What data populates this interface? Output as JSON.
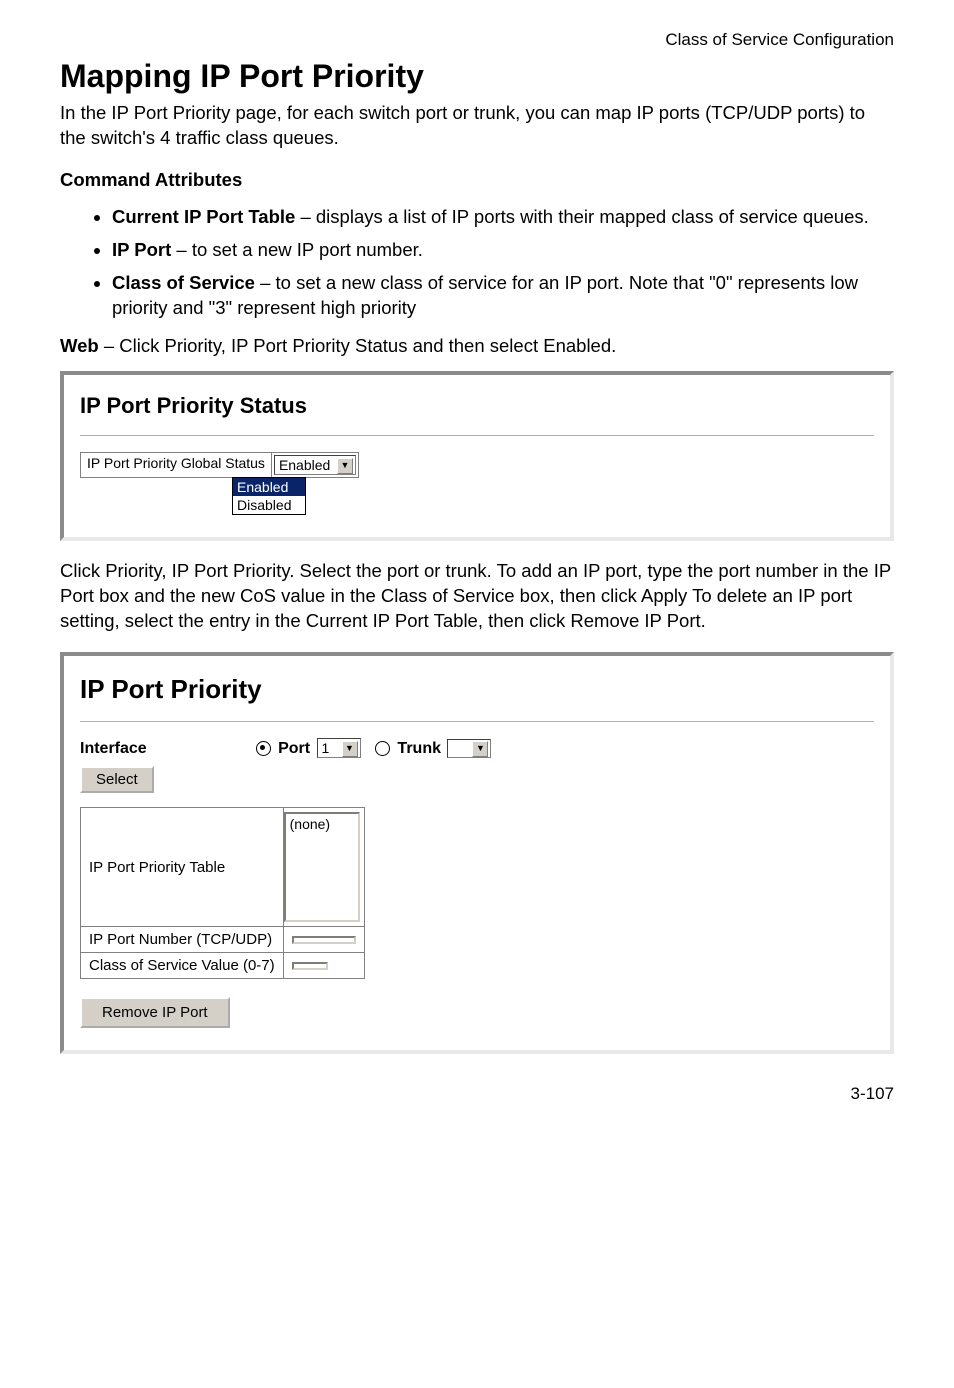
{
  "header_right": "Class of Service Configuration",
  "title": "Mapping IP Port Priority",
  "intro": "In the IP Port Priority page, for each switch port or trunk, you can map IP ports (TCP/UDP ports) to the switch's 4 traffic class queues.",
  "cmd_attr_heading": "Command Attributes",
  "attrs": [
    {
      "name": "Current IP Port Table",
      "desc": " – displays a list of IP ports with their mapped class of service queues."
    },
    {
      "name": "IP Port",
      "desc": " – to set a new IP port number."
    },
    {
      "name": "Class of Service",
      "desc": " – to set a new class of service for an IP port. Note that \"0\" represents low priority and \"3\" represent high priority"
    }
  ],
  "web_line_prefix": "Web",
  "web_line_rest": " – Click Priority, IP Port Priority Status and then select Enabled.",
  "panel1": {
    "title": "IP Port Priority Status",
    "row_label": "IP Port Priority Global Status",
    "selected": "Enabled",
    "opt_enabled": "Enabled",
    "opt_disabled": "Disabled"
  },
  "mid_para": "Click Priority, IP Port Priority. Select the port or trunk. To add an IP port, type the port number in the IP Port box and the new CoS value in the Class of Service box, then click Apply To delete an IP port setting, select the entry in the Current IP Port Table, then click Remove IP Port.",
  "panel2": {
    "title": "IP Port Priority",
    "iface_label": "Interface",
    "port_label": "Port",
    "port_value": "1",
    "trunk_label": "Trunk",
    "select_btn": "Select",
    "row_table_label": "IP Port Priority Table",
    "list_placeholder": "(none)",
    "row_ipnum_label": "IP Port Number (TCP/UDP)",
    "row_cos_label": "Class of Service Value (0-7)",
    "remove_btn": "Remove IP Port"
  },
  "page_num": "3-107"
}
